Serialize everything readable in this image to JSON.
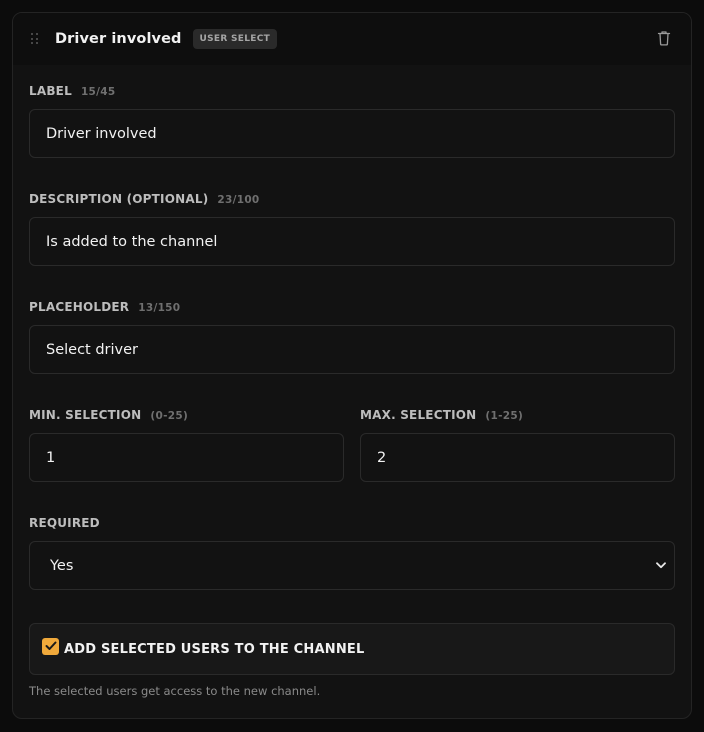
{
  "component": {
    "title": "Driver involved",
    "type_badge": "USER SELECT"
  },
  "fields": {
    "label": {
      "label": "LABEL",
      "counter": "15/45",
      "value": "Driver involved"
    },
    "description": {
      "label": "DESCRIPTION (OPTIONAL)",
      "counter": "23/100",
      "value": "Is added to the channel"
    },
    "placeholder": {
      "label": "PLACEHOLDER",
      "counter": "13/150",
      "value": "Select driver"
    },
    "min_selection": {
      "label": "MIN. SELECTION",
      "range": "(0-25)",
      "value": "1"
    },
    "max_selection": {
      "label": "MAX. SELECTION",
      "range": "(1-25)",
      "value": "2"
    },
    "required": {
      "label": "REQUIRED",
      "selected": "Yes"
    }
  },
  "checkbox": {
    "label": "ADD SELECTED USERS TO THE CHANNEL",
    "checked": true,
    "hint": "The selected users get access to the new channel."
  },
  "colors": {
    "accent": "#f0a93b",
    "background": "#121212",
    "border": "#2a2a2a"
  },
  "icons": [
    "drag-handle-icon",
    "trash-icon",
    "chevron-down-icon",
    "checkmark-icon"
  ]
}
